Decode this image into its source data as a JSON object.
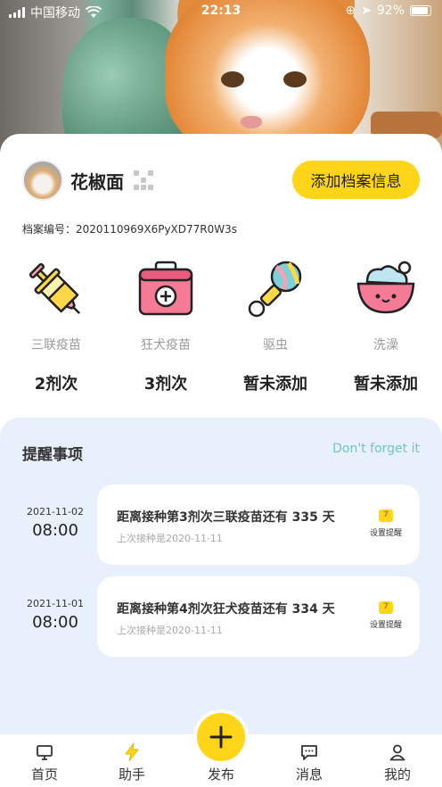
{
  "status_bar": {
    "carrier": "中国移动",
    "time": "22:13",
    "battery": "92%"
  },
  "profile": {
    "name": "花椒面",
    "add_button": "添加档案信息",
    "archive_label": "档案编号：",
    "archive_id": "2020110969X6PyXD77R0W3s"
  },
  "vaccines": [
    {
      "label": "三联疫苗",
      "count": "2剂次",
      "icon": "syringe-icon"
    },
    {
      "label": "狂犬疫苗",
      "count": "3剂次",
      "icon": "medical-kit-icon"
    },
    {
      "label": "驱虫",
      "count": "暂未添加",
      "icon": "rattle-icon"
    },
    {
      "label": "洗澡",
      "count": "暂未添加",
      "icon": "bath-tub-icon"
    }
  ],
  "reminders": {
    "title": "提醒事项",
    "subtitle": "Don't forget it",
    "items": [
      {
        "date": "2021-11-02",
        "time": "08:00",
        "text_prefix": "距离接种第3剂次三联疫苗还有",
        "days": "335",
        "text_suffix": "天",
        "last": "上次接种是2020-11-11",
        "set_label": "设置提醒"
      },
      {
        "date": "2021-11-01",
        "time": "08:00",
        "text_prefix": "距离接种第4剂次狂犬疫苗还有",
        "days": "334",
        "text_suffix": "天",
        "last": "上次接种是2020-11-11",
        "set_label": "设置提醒"
      }
    ]
  },
  "tabbar": {
    "home": "首页",
    "assistant": "助手",
    "publish": "发布",
    "messages": "消息",
    "mine": "我的",
    "active_color": "#ffd51a"
  }
}
